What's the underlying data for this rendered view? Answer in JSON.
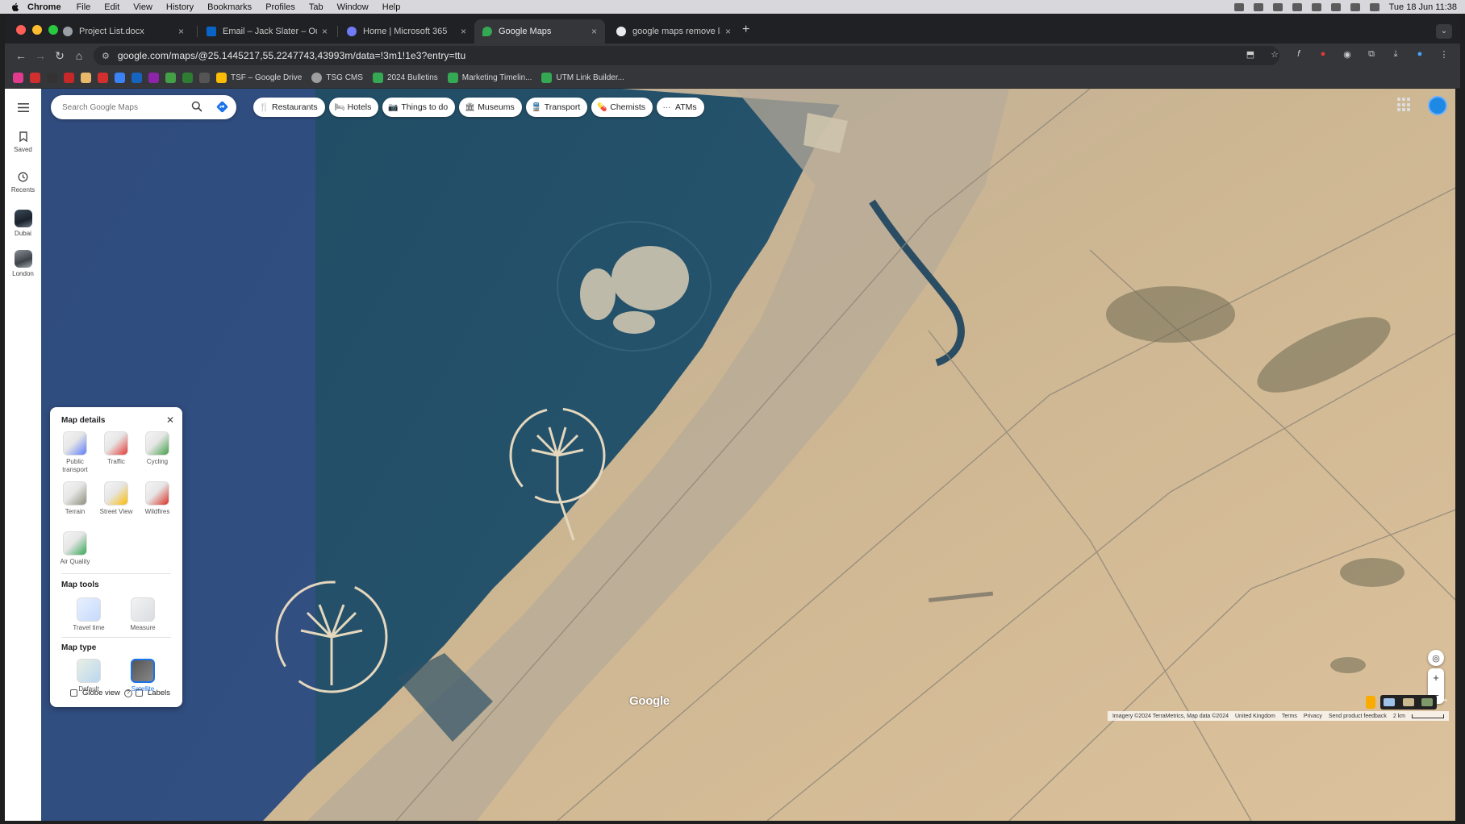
{
  "menubar": {
    "app": "Chrome",
    "items": [
      "File",
      "Edit",
      "View",
      "History",
      "Bookmarks",
      "Profiles",
      "Tab",
      "Window",
      "Help"
    ],
    "clock": "Tue 18 Jun  11:38"
  },
  "tabs": [
    {
      "label": "Project List.docx",
      "color": "#9aa0a6"
    },
    {
      "label": "Email – Jack Slater – Outlook",
      "color": "#0a64c8"
    },
    {
      "label": "Home | Microsoft 365",
      "color": "#6f7bf7"
    },
    {
      "label": "Google Maps",
      "color": "#34a853"
    },
    {
      "label": "google maps remove labels o",
      "color": "#e8eaed"
    }
  ],
  "new_tab": "+",
  "url": "google.com/maps/@25.1445217,55.2247743,43993m/data=!3m1!1e3?entry=ttu",
  "bookmarks": [
    {
      "label": "TSF – Google Drive",
      "color": "#fbbc04"
    },
    {
      "label": "TSG CMS",
      "color": "#9e9e9e"
    },
    {
      "label": "2024 Bulletins",
      "color": "#34a853"
    },
    {
      "label": "Marketing Timelin...",
      "color": "#34a853"
    },
    {
      "label": "UTM Link Builder...",
      "color": "#34a853"
    }
  ],
  "bookmark_icon_colors": [
    "#e23a8c",
    "#d12f2f",
    "#333333",
    "#c62828",
    "#e8b86b",
    "#d32f2f",
    "#3b82f6",
    "#1565c0",
    "#8e24aa",
    "#43a047",
    "#2e7d32",
    "#555555"
  ],
  "rail": {
    "saved": "Saved",
    "recents": "Recents",
    "places": [
      "Dubai",
      "London"
    ]
  },
  "search": {
    "placeholder": "Search Google Maps"
  },
  "chips": [
    {
      "label": "Restaurants",
      "icon": "fork-knife-icon",
      "glyph": "🍴"
    },
    {
      "label": "Hotels",
      "icon": "bed-icon",
      "glyph": "🛏"
    },
    {
      "label": "Things to do",
      "icon": "camera-icon",
      "glyph": "📷"
    },
    {
      "label": "Museums",
      "icon": "museum-icon",
      "glyph": "🏛"
    },
    {
      "label": "Transport",
      "icon": "train-icon",
      "glyph": "🚆"
    },
    {
      "label": "Chemists",
      "icon": "pharmacy-icon",
      "glyph": "💊"
    },
    {
      "label": "ATMs",
      "icon": "more-icon",
      "glyph": "···"
    }
  ],
  "panel": {
    "title": "Map details",
    "details": [
      {
        "label": "Public transport",
        "color": "#5c7cfa"
      },
      {
        "label": "Traffic",
        "color": "#e53935"
      },
      {
        "label": "Cycling",
        "color": "#43a047"
      },
      {
        "label": "Terrain",
        "color": "#8d8d7a"
      },
      {
        "label": "Street View",
        "color": "#fbbc04"
      },
      {
        "label": "Wildfires",
        "color": "#d93025"
      },
      {
        "label": "Air Quality",
        "color": "#34a853"
      }
    ],
    "tools_title": "Map tools",
    "tools": [
      "Travel time",
      "Measure"
    ],
    "type_title": "Map type",
    "types": [
      {
        "label": "Default",
        "selected": false
      },
      {
        "label": "Satellite",
        "selected": true
      }
    ],
    "globe_view": "Globe view",
    "labels": "Labels"
  },
  "map": {
    "logo": "Google",
    "footer": [
      "Imagery ©2024 TerraMetrics, Map data ©2024",
      "United Kingdom",
      "Terms",
      "Privacy",
      "Send product feedback",
      "2 km"
    ],
    "colors": {
      "sea": "#2b5a74",
      "sea_dark": "#1f4a62",
      "desert": "#d7bd96",
      "city": "#b9ae9c"
    }
  }
}
